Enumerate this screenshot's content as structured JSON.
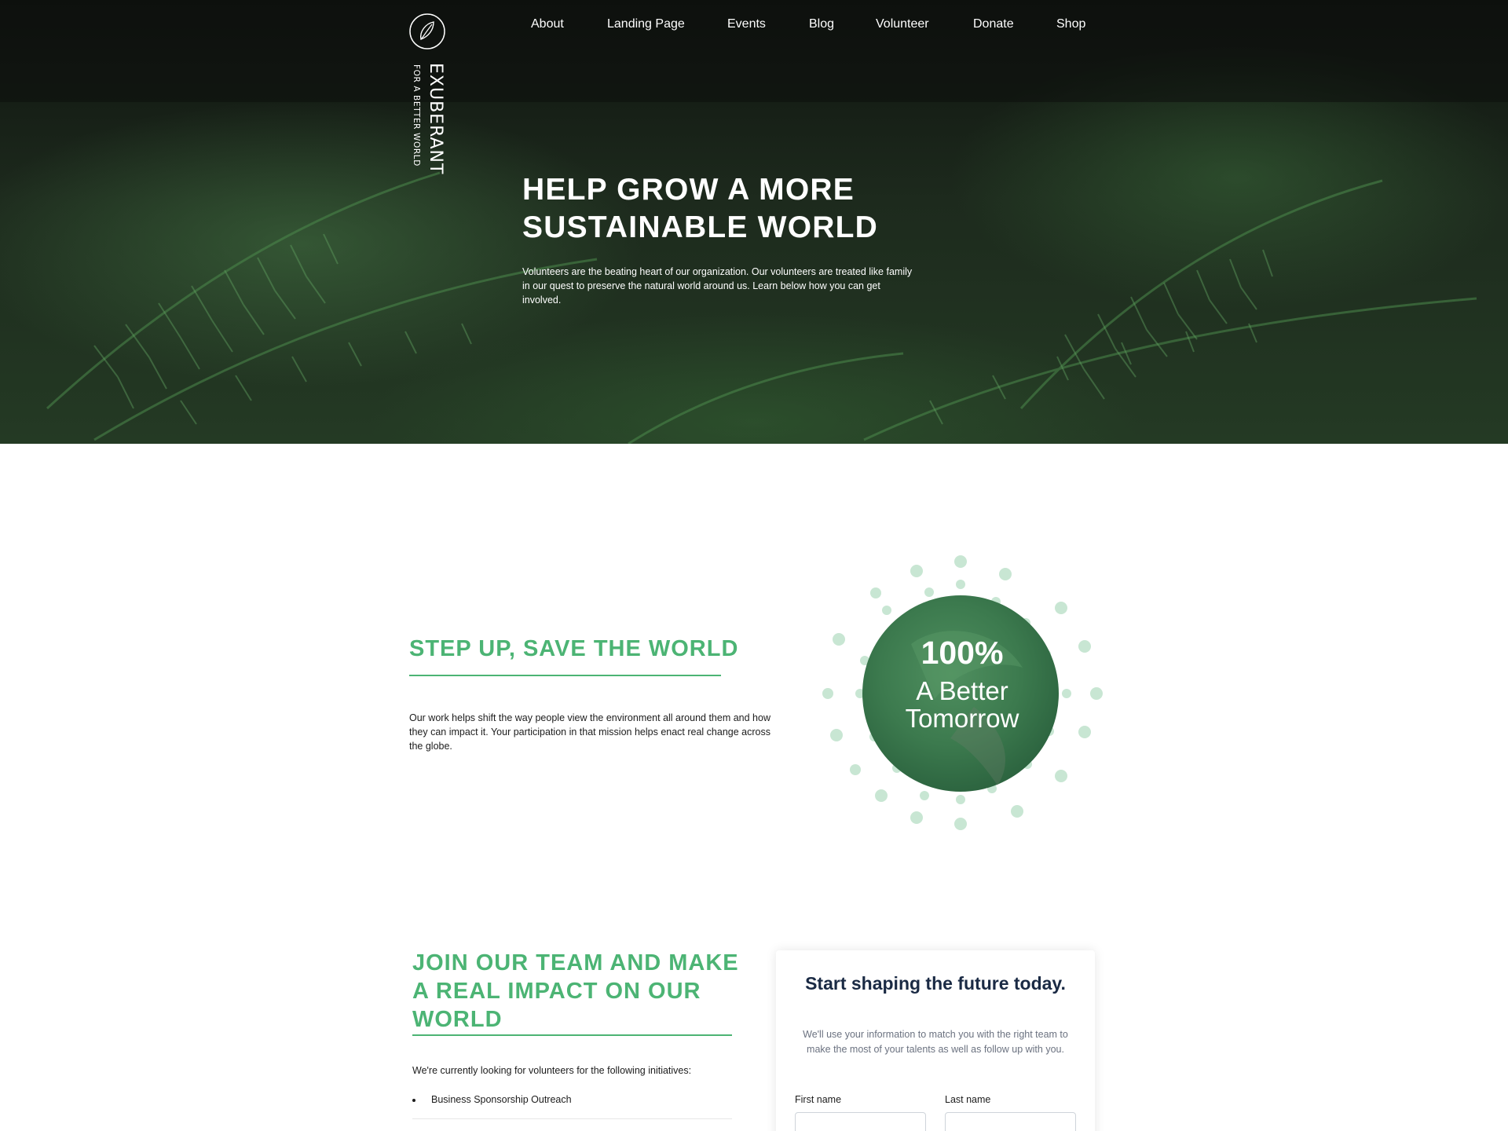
{
  "brand": {
    "name": "EXUBERANT",
    "tagline": "FOR A BETTER WORLD",
    "logo_icon": "leaf-monogram-icon"
  },
  "nav": {
    "items": [
      {
        "label": "About"
      },
      {
        "label": "Landing Page"
      },
      {
        "label": "Events"
      },
      {
        "label": "Blog"
      },
      {
        "label": "Volunteer"
      },
      {
        "label": "Donate"
      },
      {
        "label": "Shop"
      }
    ]
  },
  "hero": {
    "title": "HELP GROW A MORE SUSTAINABLE WORLD",
    "text": "Volunteers are the beating heart of our organization. Our volunteers are treated like family in our quest to preserve the natural world around us. Learn below how you can get involved."
  },
  "mission": {
    "title": "STEP UP, SAVE THE WORLD",
    "text": "Our work helps shift the way people view the environment all around them and how they can impact it. Your participation in that mission helps enact real change across the globe.",
    "stat_number": "100%",
    "stat_label": "A Better Tomorrow"
  },
  "join": {
    "title": "JOIN OUR TEAM AND MAKE A REAL IMPACT ON OUR WORLD",
    "intro": "We're currently looking for volunteers for the following initiatives:",
    "initiatives": [
      "Business Sponsorship Outreach"
    ]
  },
  "form": {
    "title": "Start shaping the future today.",
    "subtitle": "We'll use your information to match you with the right team to make the most of your talents as well as follow up with you.",
    "first_name_label": "First name",
    "last_name_label": "Last name"
  },
  "colors": {
    "accent": "#4cb474",
    "form_title": "#1a2a44",
    "dot": "#c8e6d3"
  }
}
